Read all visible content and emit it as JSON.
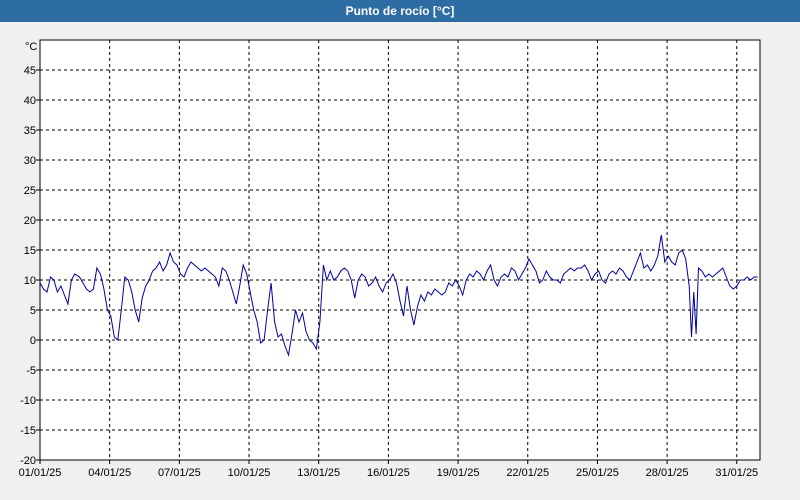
{
  "window": {
    "title": "Punto de rocío [°C]"
  },
  "chart_data": {
    "type": "line",
    "title": "Punto de rocío [°C]",
    "ylabel": "°C",
    "ylim": [
      -20,
      50
    ],
    "yticks": [
      -20,
      -15,
      -10,
      -5,
      0,
      5,
      10,
      15,
      20,
      25,
      30,
      35,
      40,
      45
    ],
    "xlim_days": [
      0,
      31
    ],
    "xticks": [
      {
        "day": 0,
        "label": "01/01/25"
      },
      {
        "day": 3,
        "label": "04/01/25"
      },
      {
        "day": 6,
        "label": "07/01/25"
      },
      {
        "day": 9,
        "label": "10/01/25"
      },
      {
        "day": 12,
        "label": "13/01/25"
      },
      {
        "day": 15,
        "label": "16/01/25"
      },
      {
        "day": 18,
        "label": "19/01/25"
      },
      {
        "day": 21,
        "label": "22/01/25"
      },
      {
        "day": 24,
        "label": "25/01/25"
      },
      {
        "day": 27,
        "label": "28/01/25"
      },
      {
        "day": 30,
        "label": "31/01/25"
      }
    ],
    "grid": true,
    "series": [
      {
        "color": "#0000a0",
        "points": [
          [
            0.0,
            9.5
          ],
          [
            0.15,
            8.5
          ],
          [
            0.3,
            8.0
          ],
          [
            0.45,
            10.5
          ],
          [
            0.6,
            10.0
          ],
          [
            0.75,
            8.0
          ],
          [
            0.9,
            9.0
          ],
          [
            1.05,
            7.5
          ],
          [
            1.2,
            6.0
          ],
          [
            1.35,
            10.0
          ],
          [
            1.5,
            11.0
          ],
          [
            1.7,
            10.5
          ],
          [
            1.85,
            9.5
          ],
          [
            2.0,
            8.5
          ],
          [
            2.15,
            8.0
          ],
          [
            2.3,
            8.5
          ],
          [
            2.45,
            12.0
          ],
          [
            2.6,
            11.0
          ],
          [
            2.75,
            8.5
          ],
          [
            2.9,
            5.0
          ],
          [
            3.05,
            4.0
          ],
          [
            3.2,
            0.5
          ],
          [
            3.35,
            0.0
          ],
          [
            3.5,
            5.0
          ],
          [
            3.65,
            10.5
          ],
          [
            3.8,
            10.0
          ],
          [
            3.95,
            8.0
          ],
          [
            4.1,
            5.0
          ],
          [
            4.25,
            3.0
          ],
          [
            4.4,
            7.0
          ],
          [
            4.55,
            9.0
          ],
          [
            4.7,
            10.0
          ],
          [
            4.85,
            11.5
          ],
          [
            5.0,
            12.0
          ],
          [
            5.15,
            13.0
          ],
          [
            5.3,
            11.5
          ],
          [
            5.45,
            12.5
          ],
          [
            5.6,
            14.5
          ],
          [
            5.75,
            13.0
          ],
          [
            5.9,
            12.5
          ],
          [
            6.05,
            11.0
          ],
          [
            6.2,
            10.5
          ],
          [
            6.35,
            12.0
          ],
          [
            6.5,
            13.0
          ],
          [
            6.65,
            12.5
          ],
          [
            6.8,
            12.0
          ],
          [
            6.95,
            11.5
          ],
          [
            7.1,
            12.0
          ],
          [
            7.25,
            11.5
          ],
          [
            7.4,
            11.0
          ],
          [
            7.55,
            10.5
          ],
          [
            7.7,
            9.0
          ],
          [
            7.85,
            12.0
          ],
          [
            8.0,
            11.5
          ],
          [
            8.15,
            10.0
          ],
          [
            8.3,
            8.0
          ],
          [
            8.45,
            6.0
          ],
          [
            8.6,
            9.0
          ],
          [
            8.75,
            12.5
          ],
          [
            8.9,
            11.0
          ],
          [
            9.05,
            8.0
          ],
          [
            9.2,
            5.0
          ],
          [
            9.35,
            3.0
          ],
          [
            9.5,
            -0.5
          ],
          [
            9.65,
            0.0
          ],
          [
            9.8,
            5.0
          ],
          [
            9.95,
            9.5
          ],
          [
            10.1,
            3.0
          ],
          [
            10.25,
            0.5
          ],
          [
            10.4,
            1.0
          ],
          [
            10.55,
            -1.0
          ],
          [
            10.7,
            -2.5
          ],
          [
            10.85,
            1.0
          ],
          [
            11.0,
            5.0
          ],
          [
            11.15,
            3.0
          ],
          [
            11.3,
            4.5
          ],
          [
            11.45,
            1.5
          ],
          [
            11.6,
            0.0
          ],
          [
            11.75,
            -0.5
          ],
          [
            11.9,
            -1.5
          ],
          [
            12.05,
            3.0
          ],
          [
            12.2,
            12.5
          ],
          [
            12.35,
            10.0
          ],
          [
            12.5,
            11.5
          ],
          [
            12.65,
            10.0
          ],
          [
            12.8,
            10.5
          ],
          [
            12.95,
            11.5
          ],
          [
            13.1,
            12.0
          ],
          [
            13.25,
            11.5
          ],
          [
            13.4,
            10.0
          ],
          [
            13.55,
            7.0
          ],
          [
            13.7,
            10.0
          ],
          [
            13.85,
            11.0
          ],
          [
            14.0,
            10.5
          ],
          [
            14.15,
            9.0
          ],
          [
            14.3,
            9.5
          ],
          [
            14.45,
            10.5
          ],
          [
            14.6,
            9.0
          ],
          [
            14.75,
            8.0
          ],
          [
            14.9,
            9.5
          ],
          [
            15.05,
            10.0
          ],
          [
            15.2,
            11.0
          ],
          [
            15.35,
            9.5
          ],
          [
            15.5,
            6.5
          ],
          [
            15.65,
            4.0
          ],
          [
            15.8,
            9.0
          ],
          [
            15.95,
            5.0
          ],
          [
            16.1,
            2.5
          ],
          [
            16.25,
            5.5
          ],
          [
            16.4,
            7.5
          ],
          [
            16.55,
            6.5
          ],
          [
            16.7,
            8.0
          ],
          [
            16.85,
            7.5
          ],
          [
            17.0,
            8.5
          ],
          [
            17.15,
            8.0
          ],
          [
            17.3,
            7.5
          ],
          [
            17.45,
            8.0
          ],
          [
            17.6,
            9.5
          ],
          [
            17.75,
            9.0
          ],
          [
            17.9,
            10.0
          ],
          [
            18.05,
            9.0
          ],
          [
            18.2,
            7.5
          ],
          [
            18.35,
            10.0
          ],
          [
            18.5,
            11.0
          ],
          [
            18.65,
            10.5
          ],
          [
            18.8,
            11.5
          ],
          [
            18.95,
            11.0
          ],
          [
            19.1,
            10.0
          ],
          [
            19.25,
            11.5
          ],
          [
            19.4,
            12.5
          ],
          [
            19.55,
            10.0
          ],
          [
            19.7,
            9.0
          ],
          [
            19.85,
            10.5
          ],
          [
            20.0,
            11.0
          ],
          [
            20.15,
            10.5
          ],
          [
            20.3,
            12.0
          ],
          [
            20.45,
            11.5
          ],
          [
            20.6,
            10.0
          ],
          [
            20.75,
            11.0
          ],
          [
            20.9,
            12.0
          ],
          [
            21.05,
            13.5
          ],
          [
            21.2,
            12.5
          ],
          [
            21.35,
            11.5
          ],
          [
            21.5,
            9.5
          ],
          [
            21.65,
            10.0
          ],
          [
            21.8,
            11.5
          ],
          [
            21.95,
            10.5
          ],
          [
            22.1,
            10.0
          ],
          [
            22.25,
            10.0
          ],
          [
            22.4,
            9.5
          ],
          [
            22.55,
            11.0
          ],
          [
            22.7,
            11.5
          ],
          [
            22.85,
            12.0
          ],
          [
            23.0,
            11.5
          ],
          [
            23.15,
            12.0
          ],
          [
            23.3,
            12.0
          ],
          [
            23.45,
            12.5
          ],
          [
            23.6,
            11.5
          ],
          [
            23.75,
            10.0
          ],
          [
            23.9,
            11.0
          ],
          [
            24.05,
            11.5
          ],
          [
            24.2,
            10.0
          ],
          [
            24.35,
            9.5
          ],
          [
            24.5,
            11.0
          ],
          [
            24.65,
            11.5
          ],
          [
            24.8,
            11.0
          ],
          [
            24.95,
            12.0
          ],
          [
            25.1,
            11.5
          ],
          [
            25.25,
            10.5
          ],
          [
            25.4,
            10.0
          ],
          [
            25.55,
            11.5
          ],
          [
            25.7,
            13.0
          ],
          [
            25.85,
            14.5
          ],
          [
            26.0,
            12.0
          ],
          [
            26.15,
            12.5
          ],
          [
            26.3,
            11.5
          ],
          [
            26.45,
            12.5
          ],
          [
            26.6,
            14.0
          ],
          [
            26.75,
            17.5
          ],
          [
            26.9,
            13.0
          ],
          [
            27.05,
            14.0
          ],
          [
            27.2,
            13.0
          ],
          [
            27.35,
            12.5
          ],
          [
            27.5,
            14.5
          ],
          [
            27.65,
            15.0
          ],
          [
            27.8,
            13.5
          ],
          [
            27.95,
            9.0
          ],
          [
            28.05,
            0.5
          ],
          [
            28.15,
            8.0
          ],
          [
            28.25,
            1.0
          ],
          [
            28.35,
            12.0
          ],
          [
            28.5,
            11.5
          ],
          [
            28.65,
            10.5
          ],
          [
            28.8,
            11.0
          ],
          [
            28.95,
            10.5
          ],
          [
            29.1,
            11.0
          ],
          [
            29.25,
            11.5
          ],
          [
            29.4,
            12.0
          ],
          [
            29.55,
            10.5
          ],
          [
            29.7,
            9.0
          ],
          [
            29.85,
            8.5
          ],
          [
            30.0,
            9.0
          ],
          [
            30.15,
            10.0
          ],
          [
            30.3,
            10.0
          ],
          [
            30.45,
            10.5
          ],
          [
            30.6,
            10.0
          ],
          [
            30.75,
            10.5
          ],
          [
            30.9,
            10.5
          ]
        ]
      }
    ]
  }
}
